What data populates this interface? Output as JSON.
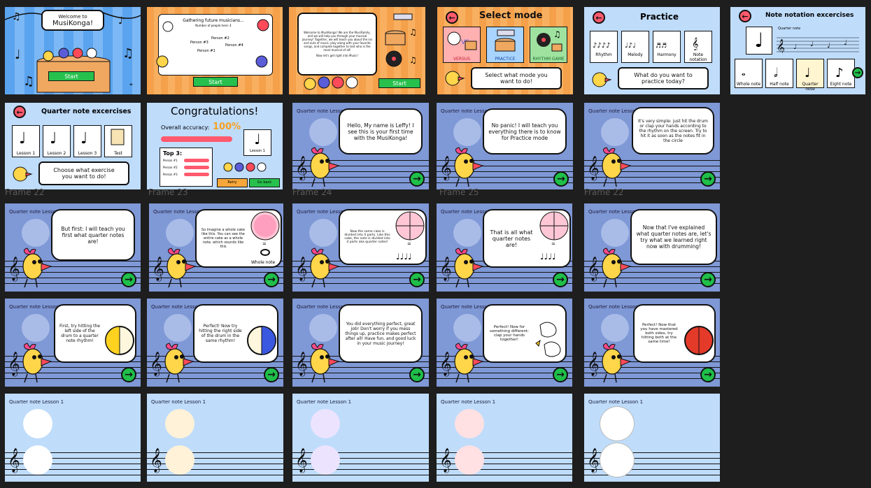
{
  "colors": {
    "bg": "#1e1e1e",
    "blue": "#7f98d6",
    "light_blue": "#bfdcfb",
    "orange": "#f6a04e",
    "green": "#1fbf49",
    "red": "#ff5a6e"
  },
  "row2_labels": [
    "Frame 22",
    "Frame 23",
    "Frame 24",
    "Frame 25",
    "Frame 22"
  ],
  "welcome": {
    "bubble_l1": "Welcome to",
    "bubble_l2": "MusiKonga!",
    "start": "Start"
  },
  "gathering": {
    "title": "Gathering future musicians...",
    "subtitle": "Number of people here: 4",
    "p1": "Person #1",
    "p2": "Person #2",
    "p3": "Person #3",
    "p4": "Person #4",
    "start": "Start"
  },
  "intro": {
    "text": "Welcome to MusiKonga! We are the MusiFamily, and we will help you through your musical journey! Together, we will teach you about the ins and outs of music, play along with your favorite songs, and compete together to test who is the most musical of all!",
    "text2": "Now let's get right into Music!",
    "start": "Start"
  },
  "select_mode": {
    "title": "Select mode",
    "versus": "VERSUS",
    "practice": "PRACTICE",
    "rhythm": "RHYTHM GAME",
    "prompt": "Select what mode you want to do!",
    "vs": "VS"
  },
  "practice": {
    "title": "Practice",
    "items": [
      "Rhythm",
      "Melody",
      "Harmony",
      "Note notation"
    ],
    "prompt": "What do you want to practice today?"
  },
  "note_notation": {
    "title": "Note notation excercises",
    "staff_label": "Quarter note",
    "items": [
      "Whole note",
      "Half note",
      "Quarter note",
      "Eight note"
    ]
  },
  "quarter_ex": {
    "title": "Quarter note excercises",
    "items": [
      "Lesson 1",
      "Lesson 2",
      "Lesson 3",
      "Test"
    ],
    "prompt": "Choose what exercise you want to do!"
  },
  "congrats": {
    "title": "Congratulations!",
    "accuracy_label": "Overall accuracy:",
    "accuracy": "100%",
    "accuracy_value": 1.0,
    "lesson": "Lesson 1",
    "top": "Top 3:",
    "persons": [
      "Person #1",
      "Person #2",
      "Person #3"
    ],
    "retry": "Retry",
    "goback": "Go back"
  },
  "lesson_title": "Quarter note Lesson 1",
  "bubbles": {
    "hello": "Hello, My name is Leffy! I see this is your first time with the MusiKonga!",
    "panic": "No panic! I will teach you everything there is to know for Practice mode",
    "simple": "It's very simple: just hit the drum or clap your hands according to the rhythm on the screen. Try to hit it as soon as the notes fit in the circle",
    "butfirst": "But first: I will teach you first what quarter notes are!",
    "cake": "So imagine a whole cake like this. You can see the entire cake as a whole note, which sounds like this",
    "cake_label": "Whole note",
    "divided": "Now the same cake is divided into 4 parts. Like this cake, the note is divided into 4 parts aka quarter notes!",
    "thatis": "That is all what quarter notes are!",
    "nowthat": "Now that I've explained what quarter notes are, let's try what we learned right now with drumming!",
    "left": "First, try hitting the left side of the drum to a quarter note rhythm!",
    "right": "Perfect! Now try hitting the right side of the drum in the same rhythm!",
    "great": "You did everything perfect, great job! Don't worry if you mess things up, practice makes perfect after all! Have fun, and good luck in your music journey!",
    "clap": "Perfect! Now for something different: clap your hands together!",
    "both": "Perfect! Now that you have mastered both sides, try hitting both at the same time!"
  },
  "icons": {
    "next": "arrow-right-icon",
    "back": "arrow-left-icon"
  }
}
